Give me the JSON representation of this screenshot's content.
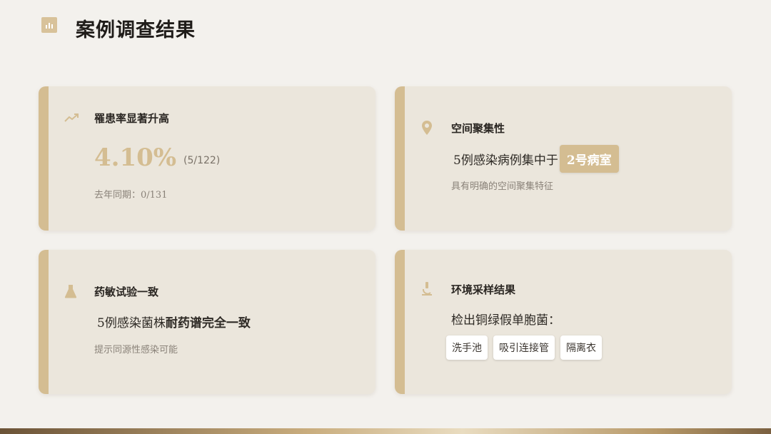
{
  "title": "案例调查结果",
  "colors": {
    "accent": "#d4bd92",
    "background": "#f3f1ed",
    "card": "#ebe6dc"
  },
  "cards": [
    {
      "icon": "trend-up-icon",
      "heading": "罹患率显著升高",
      "value": "4.10%",
      "fraction": "(5/122)",
      "note": "去年同期：0/131"
    },
    {
      "icon": "location-pin-icon",
      "heading": "空间聚集性",
      "line_prefix": "5例感染病例集中于",
      "highlight": "2号病室",
      "note": "具有明确的空间聚集特征"
    },
    {
      "icon": "flask-icon",
      "heading": "药敏试验一致",
      "line_prefix": "5例感染菌株",
      "line_bold": "耐药谱",
      "line_suffix": "完全一致",
      "note": "提示同源性感染可能"
    },
    {
      "icon": "microscope-icon",
      "heading": "环境采样结果",
      "line": "检出铜绿假单胞菌：",
      "tags": [
        "洗手池",
        "吸引连接管",
        "隔离衣"
      ]
    }
  ]
}
